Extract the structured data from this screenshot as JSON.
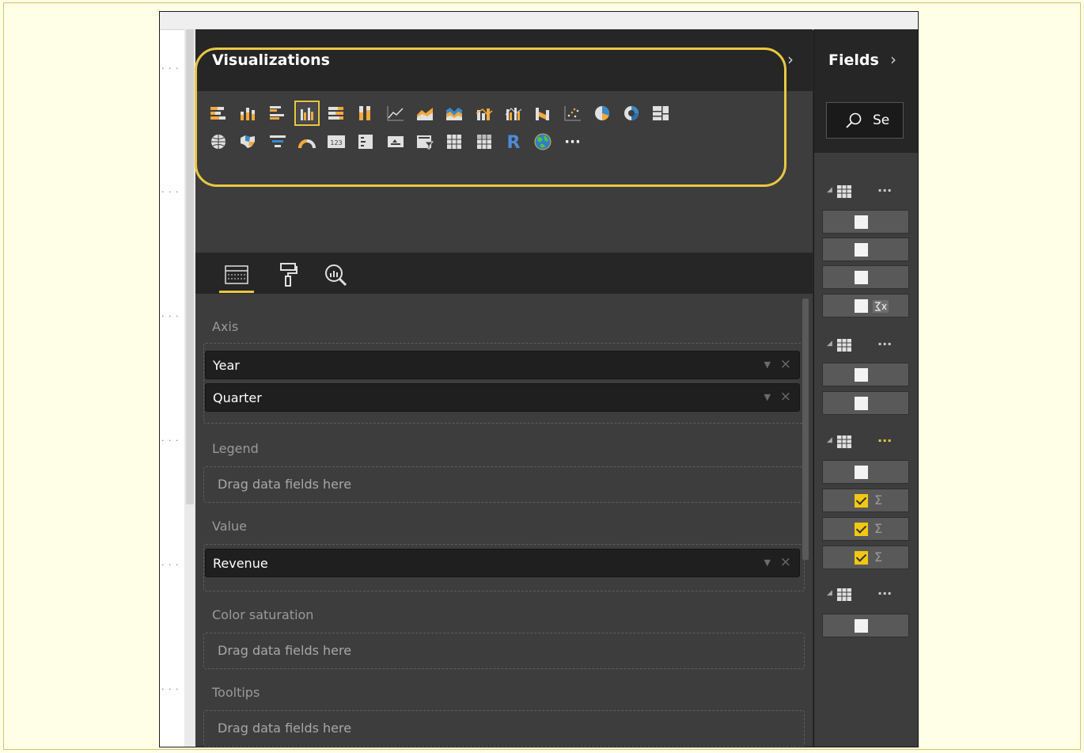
{
  "visualizations": {
    "title": "Visualizations",
    "icons": [
      "stacked-bar-chart-icon",
      "stacked-column-chart-icon",
      "clustered-bar-chart-icon",
      "clustered-column-chart-icon",
      "100-stacked-bar-chart-icon",
      "100-stacked-column-chart-icon",
      "line-chart-icon",
      "area-chart-icon",
      "stacked-area-chart-icon",
      "line-stacked-column-chart-icon",
      "line-clustered-column-chart-icon",
      "ribbon-chart-icon",
      "scatter-chart-icon",
      "pie-chart-icon",
      "donut-chart-icon",
      "treemap-icon",
      "map-icon",
      "filled-map-icon",
      "funnel-icon",
      "gauge-icon",
      "card-icon",
      "multi-row-card-icon",
      "kpi-icon",
      "slicer-icon",
      "table-icon",
      "matrix-icon",
      "r-visual-icon",
      "globe-icon",
      "more-visuals-icon"
    ],
    "selected_icon": "clustered-column-chart-icon",
    "more": "···",
    "r_letter": "R",
    "card_digits": "123"
  },
  "tabs": [
    "fields-tab",
    "format-tab",
    "analytics-tab"
  ],
  "wells": {
    "axis": {
      "label": "Axis",
      "fields": [
        "Year",
        "Quarter"
      ]
    },
    "legend": {
      "label": "Legend",
      "placeholder": "Drag data fields here"
    },
    "value": {
      "label": "Value",
      "fields": [
        "Revenue"
      ]
    },
    "color_saturation": {
      "label": "Color saturation",
      "placeholder": "Drag data fields here"
    },
    "tooltips": {
      "label": "Tooltips",
      "placeholder": "Drag data fields here"
    }
  },
  "fields_pane": {
    "title": "Fields",
    "search_text": "Se",
    "ellipsis": "..."
  },
  "colors": {
    "accent": "#e8c842",
    "pane_bg": "#3d3d3d",
    "header_bg": "#262626",
    "icon_orange": "#f2a93b"
  }
}
